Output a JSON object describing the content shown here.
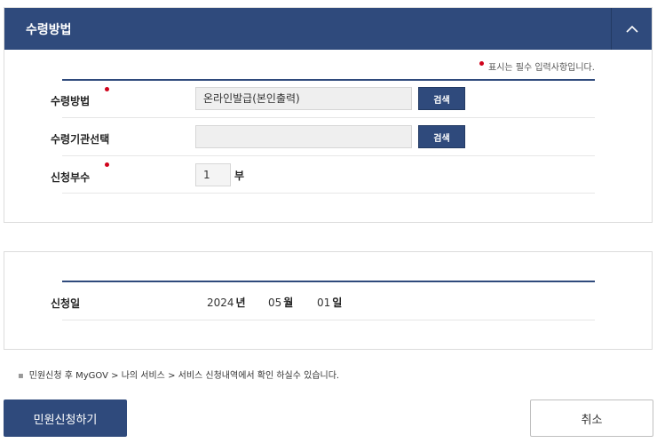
{
  "receipt_section": {
    "title": "수령방법",
    "required_note": "표시는 필수 입력사항입니다.",
    "method": {
      "label": "수령방법",
      "value": "온라인발급(본인출력)",
      "search_label": "검색"
    },
    "agency": {
      "label": "수령기관선택",
      "value": "",
      "search_label": "검색"
    },
    "copies": {
      "label": "신청부수",
      "value": "1",
      "unit": "부"
    }
  },
  "date_section": {
    "label": "신청일",
    "year": "2024",
    "year_unit": "년",
    "month": "05",
    "month_unit": "월",
    "day": "01",
    "day_unit": "일"
  },
  "notice": "민원신청 후 MyGOV > 나의 서비스 > 서비스 신청내역에서 확인 하실수 있습니다.",
  "actions": {
    "submit_label": "민원신청하기",
    "cancel_label": "취소"
  },
  "colors": {
    "primary": "#2f4a7c",
    "required_dot": "#d0021b"
  },
  "icons": {
    "collapse": "chevron-up-icon",
    "bullet": "bullet-icon"
  }
}
